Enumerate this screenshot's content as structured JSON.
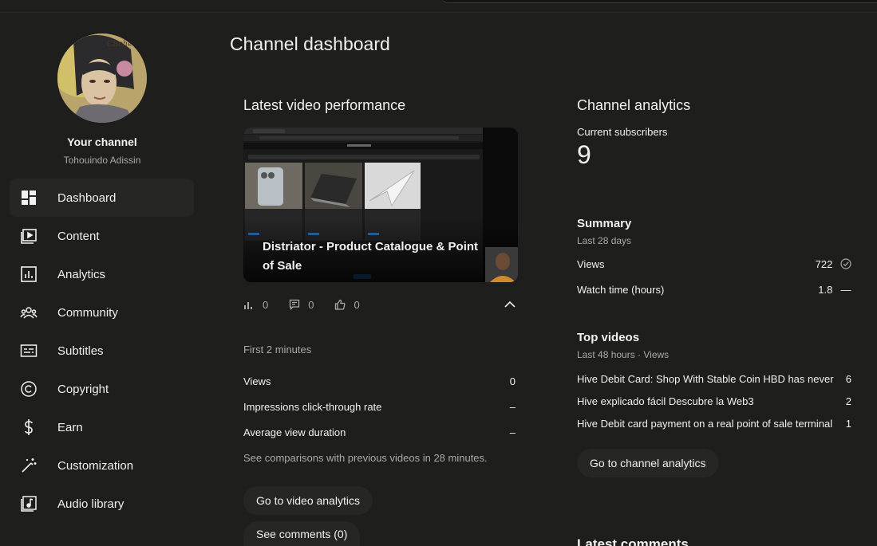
{
  "sidebar": {
    "channel_title": "Your channel",
    "channel_name": "Tohouindo Adissin",
    "items": [
      {
        "label": "Dashboard",
        "icon": "dashboard-icon"
      },
      {
        "label": "Content",
        "icon": "content-icon"
      },
      {
        "label": "Analytics",
        "icon": "analytics-icon"
      },
      {
        "label": "Community",
        "icon": "community-icon"
      },
      {
        "label": "Subtitles",
        "icon": "subtitles-icon"
      },
      {
        "label": "Copyright",
        "icon": "copyright-icon"
      },
      {
        "label": "Earn",
        "icon": "dollar-icon"
      },
      {
        "label": "Customization",
        "icon": "magic-wand-icon"
      },
      {
        "label": "Audio library",
        "icon": "audio-library-icon"
      }
    ]
  },
  "main": {
    "page_title": "Channel dashboard",
    "latest_video": {
      "title": "Latest video performance",
      "video_title": "Distriator - Product Catalogue & Point of Sale",
      "views": "0",
      "comments": "0",
      "likes": "0",
      "period": "First 2 minutes",
      "metrics": [
        {
          "label": "Views",
          "value": "0"
        },
        {
          "label": "Impressions click-through rate",
          "value": "–"
        },
        {
          "label": "Average view duration",
          "value": "–"
        }
      ],
      "note": "See comparisons with previous videos in 28 minutes.",
      "analytics_button": "Go to video analytics",
      "comments_button": "See comments (0)"
    },
    "channel_analytics": {
      "title": "Channel analytics",
      "subscribers_label": "Current subscribers",
      "subscribers": "9",
      "summary_title": "Summary",
      "summary_period": "Last 28 days",
      "summary_rows": [
        {
          "label": "Views",
          "value": "722"
        },
        {
          "label": "Watch time (hours)",
          "value": "1.8"
        }
      ],
      "watch_time_trend": "—",
      "top_videos_title": "Top videos",
      "top_videos_period": "Last 48 hours · Views",
      "top_videos": [
        {
          "title": "Hive Debit Card: Shop With Stable Coin HBD has never ...",
          "views": "6"
        },
        {
          "title": "Hive explicado fácil Descubre la Web3",
          "views": "2"
        },
        {
          "title": "Hive Debit card payment on a real point of sale terminal",
          "views": "1"
        }
      ],
      "analytics_button": "Go to channel analytics",
      "latest_comments_title": "Latest comments"
    }
  },
  "colors": {
    "background": "#1e1e1c",
    "panel": "#262624",
    "text": "#f1f1f1",
    "muted": "#aaaaaa"
  }
}
